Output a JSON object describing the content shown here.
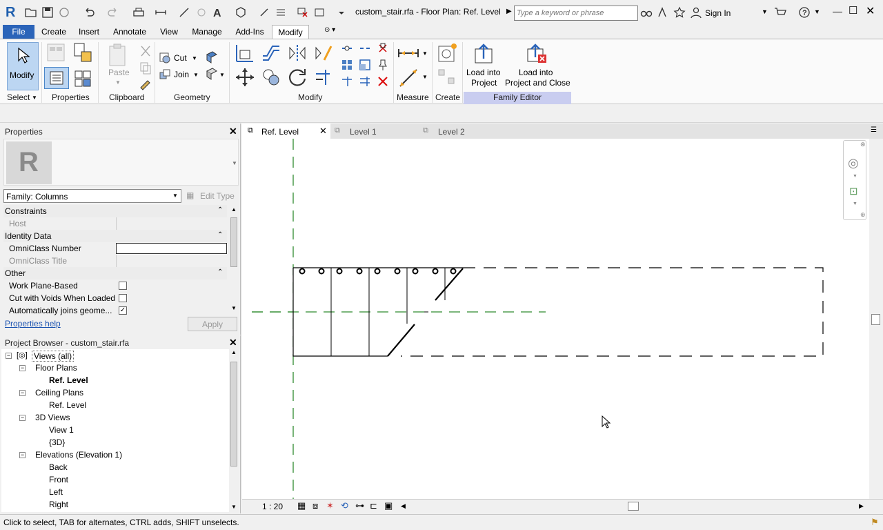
{
  "titlebar": {
    "app_logo": "R",
    "title": "custom_stair.rfa - Floor Plan: Ref. Level",
    "search_placeholder": "Type a keyword or phrase",
    "sign_in": "Sign In"
  },
  "ribbon_tabs": [
    "File",
    "Create",
    "Insert",
    "Annotate",
    "View",
    "Manage",
    "Add-Ins",
    "Modify"
  ],
  "ribbon": {
    "modify_label": "Modify",
    "select_label": "Select",
    "properties_label": "Properties",
    "clipboard_label": "Clipboard",
    "paste_label": "Paste",
    "cut_label": "Cut",
    "join_label": "Join",
    "geometry_label": "Geometry",
    "modify_panel_label": "Modify",
    "measure_label": "Measure",
    "create_label": "Create",
    "load_into_project": "Load into Project",
    "load_into_project_l1": "Load into",
    "load_into_project_l2": "Project",
    "load_close_l1": "Load into",
    "load_close_l2": "Project and Close",
    "family_editor_label": "Family Editor",
    "family_editor_color": "#c9cdf0"
  },
  "properties": {
    "title": "Properties",
    "type_icon": "R",
    "family_select": "Family: Columns",
    "edit_type": "Edit Type",
    "groups": [
      {
        "name": "Constraints"
      },
      {
        "name": "Identity Data"
      },
      {
        "name": "Other"
      }
    ],
    "rows": {
      "host": "Host",
      "omniclass_number": "OmniClass Number",
      "omniclass_title": "OmniClass Title",
      "work_plane_based": "Work Plane-Based",
      "cut_with_voids": "Cut with Voids When Loaded",
      "auto_joins": "Automatically joins geome..."
    },
    "help_link": "Properties help",
    "apply": "Apply"
  },
  "browser": {
    "title": "Project Browser - custom_stair.rfa",
    "items": {
      "views_all": "Views (all)",
      "floor_plans": "Floor Plans",
      "ref_level_fp": "Ref. Level",
      "ceiling_plans": "Ceiling Plans",
      "ref_level_cp": "Ref. Level",
      "views_3d": "3D Views",
      "view1": "View 1",
      "view3d": "{3D}",
      "elevations": "Elevations (Elevation 1)",
      "back": "Back",
      "front": "Front",
      "left": "Left",
      "right": "Right"
    }
  },
  "view_tabs": [
    "Ref. Level",
    "Level 1",
    "Level 2"
  ],
  "viewbar": {
    "scale": "1 : 20"
  },
  "statusbar": {
    "text": "Click to select, TAB for alternates, CTRL adds, SHIFT unselects."
  }
}
